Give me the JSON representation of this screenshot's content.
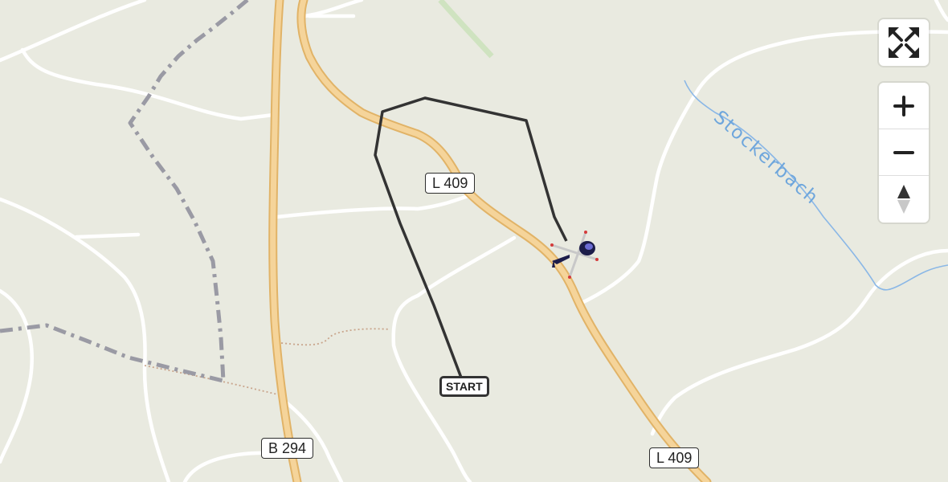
{
  "map": {
    "road_labels": [
      "L 409",
      "B 294",
      "L 409"
    ],
    "start_label": "START",
    "water_label": "Stockerbach",
    "colors": {
      "background": "#e9eae0",
      "minor_road": "#ffffff",
      "main_road": "#f5d49a",
      "main_road_casing": "#e1b367",
      "boundary": "#9a9aa4",
      "water": "#8ab7e6",
      "track": "#333333"
    }
  },
  "controls": {
    "fullscreen_icon": "fullscreen-icon",
    "zoom_in_icon": "plus-icon",
    "zoom_out_icon": "minus-icon",
    "compass_icon": "compass-icon"
  }
}
